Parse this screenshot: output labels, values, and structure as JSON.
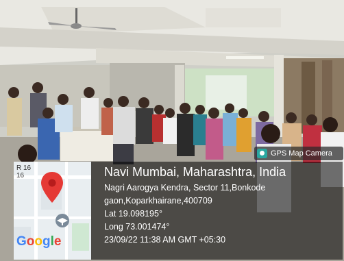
{
  "gps_badge": {
    "label": "GPS Map Camera",
    "icon": "camera-icon"
  },
  "map": {
    "road_label_line1": "R 16",
    "road_label_line2": "16",
    "brand": "Google",
    "pin_icon": "map-pin-icon",
    "school_icon": "graduation-cap-icon"
  },
  "location": {
    "title": "Navi Mumbai, Maharashtra, India",
    "address_line1": "Nagri Aarogya Kendra, Sector 11,Bonkode",
    "address_line2": "gaon,Koparkhairane,400709",
    "lat": "Lat 19.098195°",
    "long": "Long 73.001474°",
    "datetime": "23/09/22 11:38 AM GMT +05:30"
  },
  "colors": {
    "pin": "#e53935",
    "overlay": "#000000"
  }
}
